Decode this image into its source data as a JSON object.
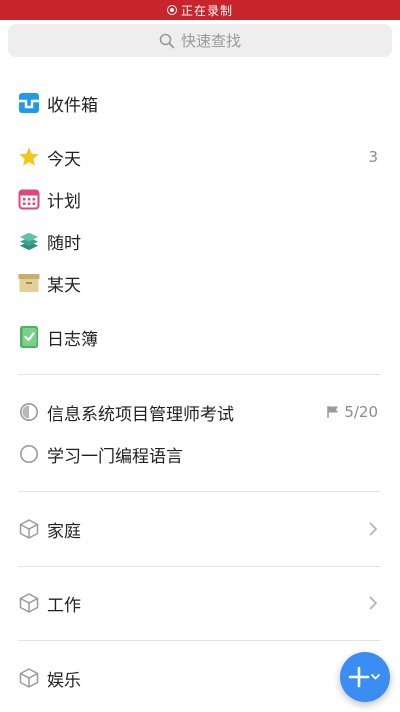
{
  "status_bar": {
    "recording_text": "正在录制"
  },
  "search": {
    "placeholder": "快速查找"
  },
  "lists": {
    "inbox": "收件箱",
    "today": "今天",
    "today_count": "3",
    "plan": "计划",
    "anytime": "随时",
    "someday": "某天",
    "logbook": "日志簿"
  },
  "projects": [
    {
      "label": "信息系统项目管理师考试",
      "progress": "5/20"
    },
    {
      "label": "学习一门编程语言"
    }
  ],
  "areas": [
    {
      "label": "家庭"
    },
    {
      "label": "工作"
    },
    {
      "label": "娱乐"
    }
  ],
  "colors": {
    "record_bar": "#c8242c",
    "accent_blue": "#3a8ef3",
    "star_yellow": "#f5c518",
    "plan_pink": "#e0457b",
    "anytime_teal": "#3aa38e",
    "someday_tan": "#d4b97a",
    "logbook_green": "#47b75c"
  }
}
